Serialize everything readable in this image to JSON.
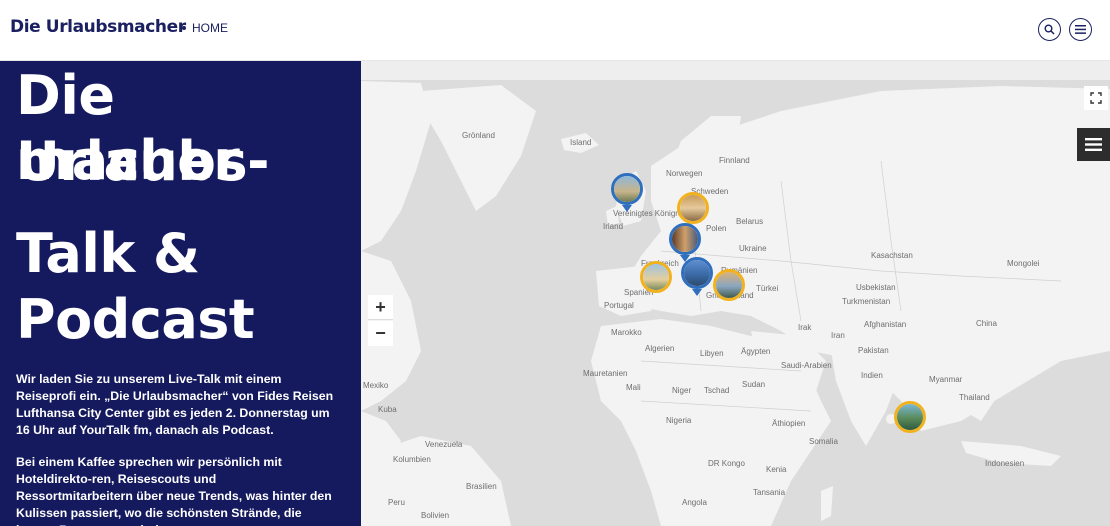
{
  "header": {
    "brand": "Die Urlaubsmacher",
    "nav_home": "HOME",
    "search_icon": "search-icon",
    "menu_icon": "hamburger-menu-icon"
  },
  "hero": {
    "title_line1": "Die Urlaubs-",
    "title_line2": "macher",
    "title_line3": "Talk &",
    "title_line4": "Podcast",
    "paragraph1": "Wir laden Sie zu unserem Live-Talk mit einem Reiseprofi ein. „Die Urlaubsmacher“ von Fides Reisen Lufthansa City Center gibt es jeden 2. Donnerstag um 16 Uhr auf YourTalk fm, danach als Podcast.",
    "paragraph2": "Bei einem Kaffee sprechen wir persönlich mit Hoteldirekto-ren, Reisescouts und Ressortmitarbeitern über neue Trends, was hinter den Kulissen passiert, wo die schönsten Strände, die besten Restaurants sind."
  },
  "map": {
    "zoom_in": "+",
    "zoom_out": "−",
    "labels": {
      "groenland": "Grönland",
      "island": "Island",
      "norwegen": "Norwegen",
      "schweden": "Schweden",
      "finnland": "Finnland",
      "vereinigtes_koenigreich": "Vereinigtes Königreich",
      "irland": "Irland",
      "polen": "Polen",
      "belarus": "Belarus",
      "ukraine": "Ukraine",
      "frankreich": "Frankreich",
      "spanien": "Spanien",
      "portugal": "Portugal",
      "rumaenien": "Rumänien",
      "griechenland": "Griechenland",
      "tuerkei": "Türkei",
      "kasachstan": "Kasachstan",
      "mongolei": "Mongolei",
      "usbekistan": "Usbekistan",
      "turkmenistan": "Turkmenistan",
      "afghanistan": "Afghanistan",
      "irak": "Irak",
      "iran": "Iran",
      "marokko": "Marokko",
      "algerien": "Algerien",
      "libyen": "Libyen",
      "aegypten": "Ägypten",
      "saudi_arabien": "Saudi-Arabien",
      "mauretanien": "Mauretanien",
      "mali": "Mali",
      "niger": "Niger",
      "tschad": "Tschad",
      "sudan": "Sudan",
      "nigeria": "Nigeria",
      "aethiopien": "Äthiopien",
      "somalia": "Somalia",
      "kenia": "Kenia",
      "tansania": "Tansania",
      "angola": "Angola",
      "kolumbien": "Kolumbien",
      "venezuela": "Venezuela",
      "peru": "Peru",
      "bolivien": "Bolivien",
      "brasilien": "Brasilien",
      "dr_kongo": "DR Kongo",
      "indien": "Indien",
      "pakistan": "Pakistan",
      "china": "China",
      "myanmar": "Myanmar",
      "thailand": "Thailand",
      "indonesien": "Indonesien",
      "kuba": "Kuba",
      "mexiko": "Mexiko"
    }
  }
}
